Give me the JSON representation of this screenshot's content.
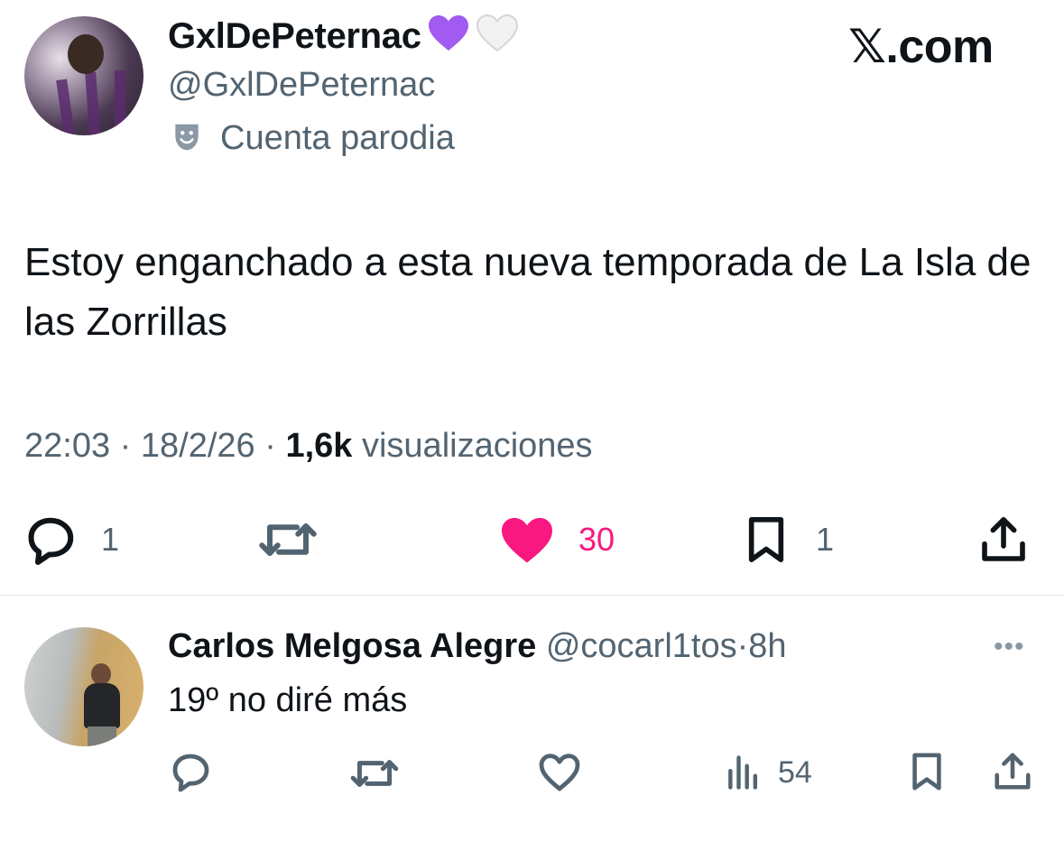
{
  "tweet": {
    "display_name": "GxlDePeternac",
    "handle": "@GxlDePeternac",
    "badge_label": "Cuenta parodia",
    "site_label": "𝕏.com",
    "text": "Estoy enganchado a esta nueva temporada de La Isla de las Zorrillas",
    "time": "22:03",
    "separator": "·",
    "date": "18/2/26",
    "views_count": "1,6k",
    "views_label": "visualizaciones",
    "actions": {
      "reply_count": "1",
      "like_count": "30",
      "bookmark_count": "1"
    }
  },
  "reply": {
    "display_name": "Carlos Melgosa Alegre",
    "handle": "@cocarl1tos",
    "separator": "·",
    "time": "8h",
    "text": "19º no diré más",
    "more_label": "•••",
    "views_count": "54"
  },
  "colors": {
    "like_active": "#f91880",
    "secondary_text": "#536471",
    "emoji_purple": "#a25bf0"
  },
  "icons": [
    "purple-heart-icon",
    "white-heart-icon",
    "theater-mask-icon",
    "reply-icon",
    "retweet-icon",
    "like-icon",
    "bookmark-icon",
    "share-icon",
    "views-icon",
    "more-icon"
  ]
}
